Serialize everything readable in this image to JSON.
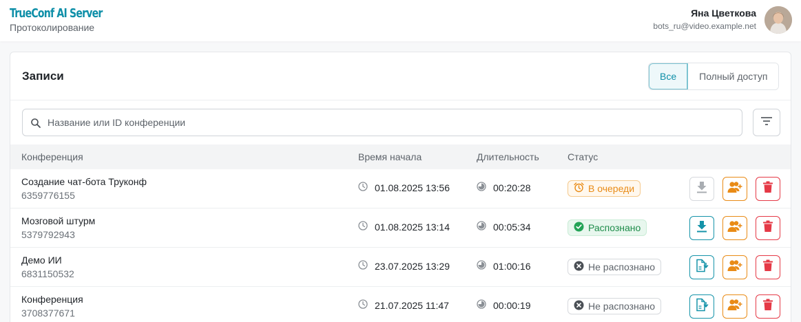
{
  "header": {
    "brand": "TrueConf AI Server",
    "section": "Протоколирование",
    "user_name": "Яна Цветкова",
    "user_email": "bots_ru@video.example.net"
  },
  "records": {
    "title": "Записи",
    "filter_all": "Все",
    "filter_full": "Полный доступ",
    "search_placeholder": "Название или ID конференции",
    "columns": {
      "conference": "Конференция",
      "start": "Время начала",
      "duration": "Длительность",
      "status": "Статус"
    },
    "rows": [
      {
        "name": "Создание чат-бота Труконф",
        "id": "6359776155",
        "start": "01.08.2025 13:56",
        "duration": "00:20:28",
        "status": "В очереди",
        "status_kind": "queue",
        "download": "disabled"
      },
      {
        "name": "Мозговой штурм",
        "id": "5379792943",
        "start": "01.08.2025 13:14",
        "duration": "00:05:34",
        "status": "Распознано",
        "status_kind": "done",
        "download": "download"
      },
      {
        "name": "Демо ИИ",
        "id": "6831150532",
        "start": "23.07.2025 13:29",
        "duration": "01:00:16",
        "status": "Не распознано",
        "status_kind": "fail",
        "download": "transcribe"
      },
      {
        "name": "Конференция",
        "id": "3708377671",
        "start": "21.07.2025 11:47",
        "duration": "00:00:19",
        "status": "Не распознано",
        "status_kind": "fail",
        "download": "transcribe"
      }
    ]
  },
  "colors": {
    "accent": "#0e8fa8",
    "warning": "#e98b16",
    "success": "#1e8c4a",
    "danger": "#e53946"
  }
}
